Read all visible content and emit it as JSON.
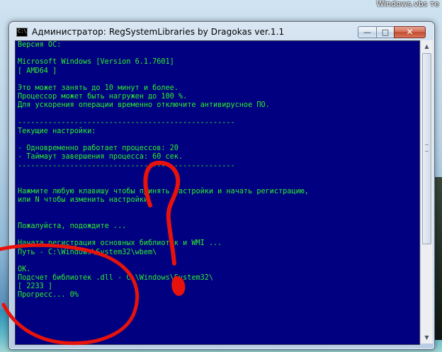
{
  "desktop": {
    "label": "Windows.vbs  те"
  },
  "window": {
    "title": "Администратор:  RegSystemLibraries by Dragokas ver.1.1",
    "app_icon_text": "C:\\",
    "controls": {
      "minimize": "—",
      "maximize": "□",
      "close": "✕"
    }
  },
  "console": {
    "lines": [
      "Версия ОС:",
      "",
      "Microsoft Windows [Version 6.1.7601]",
      "[ AMD64 ]",
      "",
      "Это может занять до 10 минут и более.",
      "Процессор может быть нагружен до 100 %.",
      "Для ускорения операции временно отключите антивирусное ПО.",
      "",
      "--------------------------------------------------",
      "Текущие настройки:",
      "",
      "- Одновременно работает процессов: 20",
      "- Таймаут завершения процесса: 60 сек.",
      "--------------------------------------------------",
      "",
      "",
      "Нажмите любую клавишу чтобы принять настройки и начать регистрацию,",
      "или N чтобы изменить настройки.",
      "",
      "",
      "Пожалуйста, подождите ...",
      "",
      "Начата регистрация основных библиотек и WMI ...",
      "Путь - C:\\Windows\\System32\\wbem\\",
      "",
      "OK.",
      "Подсчет библиотек .dll - C:\\Windows\\System32\\",
      "[ 2233 ]",
      "Прогресс... 0%"
    ]
  },
  "annotation_color": "#e8120c"
}
